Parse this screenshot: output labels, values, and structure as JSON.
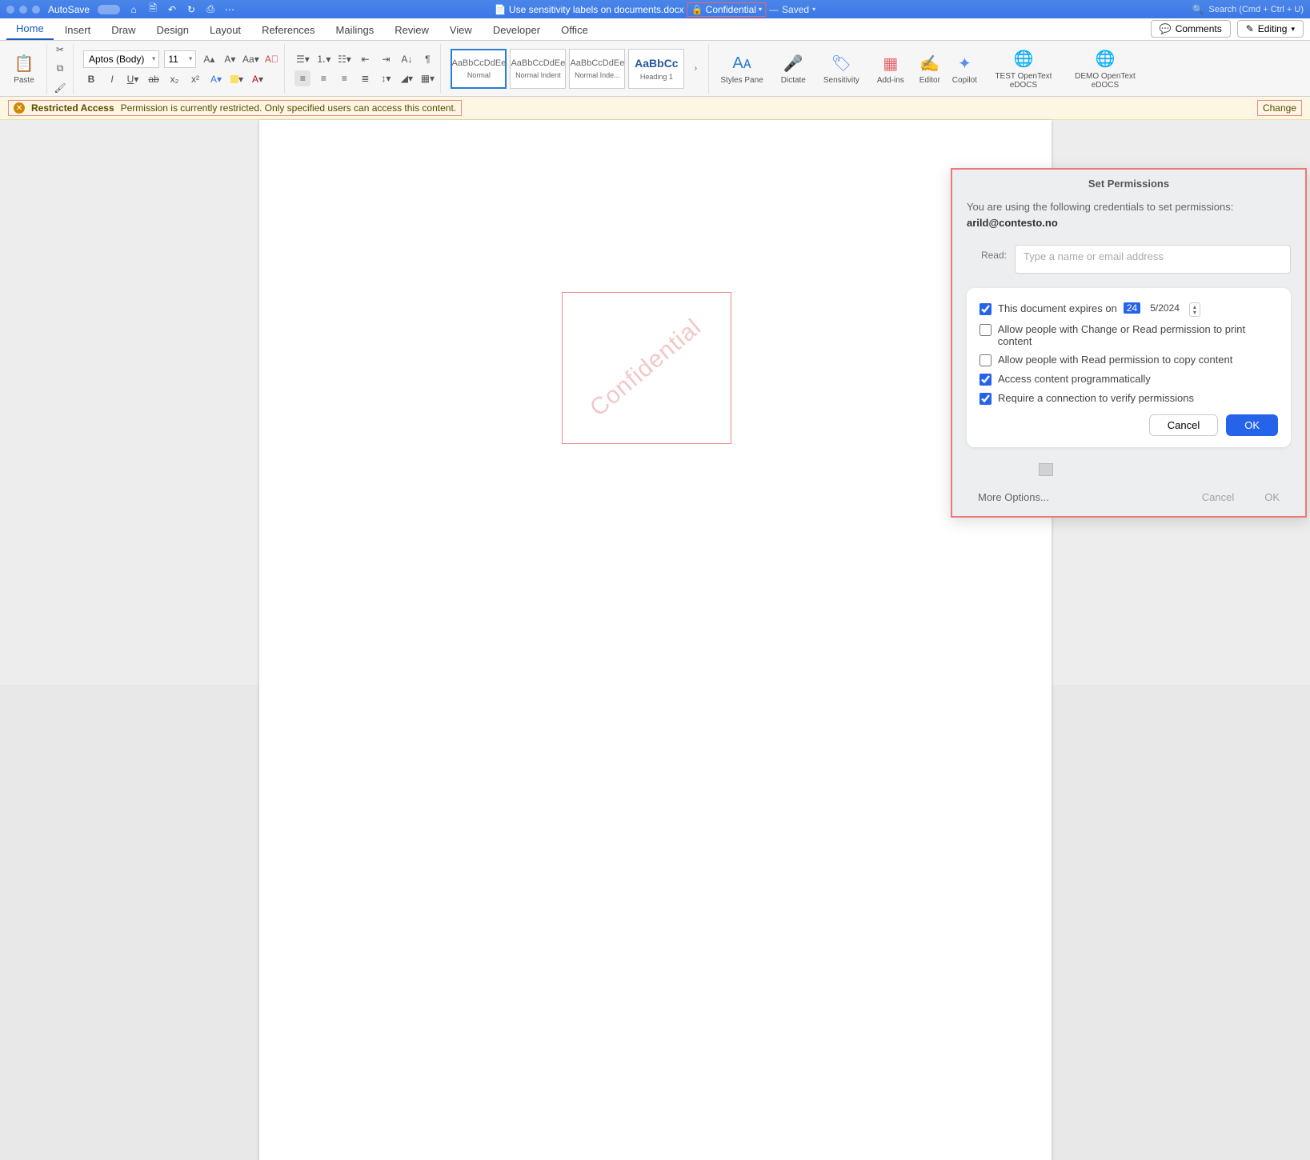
{
  "titlebar": {
    "autosave": "AutoSave",
    "doc_name": "Use sensitivity labels on documents.docx",
    "confidential_label": "Confidential",
    "saved": "Saved",
    "search_hint": "Search (Cmd + Ctrl + U)"
  },
  "tabs": {
    "items": [
      "Home",
      "Insert",
      "Draw",
      "Design",
      "Layout",
      "References",
      "Mailings",
      "Review",
      "View",
      "Developer",
      "Office"
    ],
    "active": 0,
    "comments": "Comments",
    "editing": "Editing"
  },
  "ribbon": {
    "paste": "Paste",
    "font_name": "Aptos (Body)",
    "font_size": "11",
    "styles": [
      {
        "sample": "AaBbCcDdEe",
        "label": "Normal",
        "big": false,
        "selected": true
      },
      {
        "sample": "AaBbCcDdEe",
        "label": "Normal Indent",
        "big": false,
        "selected": false
      },
      {
        "sample": "AaBbCcDdEe",
        "label": "Normal Inde...",
        "big": false,
        "selected": false
      },
      {
        "sample": "AaBbCc",
        "label": "Heading 1",
        "big": true,
        "selected": false
      }
    ],
    "styles_pane": "Styles Pane",
    "dictate": "Dictate",
    "sensitivity": "Sensitivity",
    "addins": "Add-ins",
    "editor": "Editor",
    "copilot": "Copilot",
    "test_edocs": "TEST OpenText eDOCS",
    "demo_edocs": "DEMO OpenText eDOCS"
  },
  "msgbar": {
    "title": "Restricted Access",
    "msg": "Permission is currently restricted. Only specified users can access this content.",
    "change": "Change"
  },
  "watermark": "Confidential",
  "perm": {
    "title": "Set Permissions",
    "cred_line": "You are using the following credentials to set permissions:",
    "email": "arild@contesto.no",
    "read_label": "Read:",
    "read_placeholder": "Type a name or email address",
    "opts": {
      "expires": "This document expires on",
      "expires_day": "24",
      "expires_rest": "5/2024",
      "allow_print": "Allow people with Change or Read permission to print content",
      "allow_copy": "Allow people with Read permission to copy content",
      "prog": "Access content programmatically",
      "conn": "Require a connection to verify permissions"
    },
    "cancel": "Cancel",
    "ok": "OK",
    "more": "More Options...",
    "cancel2": "Cancel",
    "ok2": "OK"
  }
}
